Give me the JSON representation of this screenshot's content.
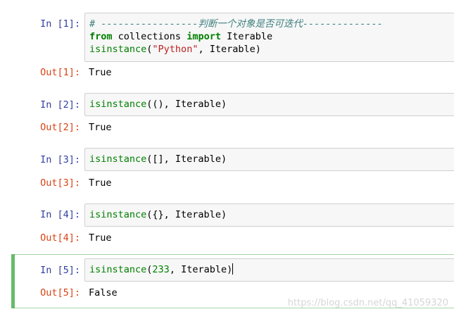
{
  "cells": [
    {
      "in_prompt": "In [1]:",
      "out_prompt": "Out[1]:",
      "code": {
        "comment": "# -----------------判断一个对象是否可迭代--------------",
        "line2_kw_from": "from",
        "line2_module": " collections ",
        "line2_kw_import": "import",
        "line2_name": " Iterable",
        "line3_func": "isinstance",
        "line3_open": "(",
        "line3_str": "\"Python\"",
        "line3_rest": ", Iterable)"
      },
      "output": "True"
    },
    {
      "in_prompt": "In [2]:",
      "out_prompt": "Out[2]:",
      "code": {
        "func": "isinstance",
        "args": "((), Iterable)"
      },
      "output": "True"
    },
    {
      "in_prompt": "In [3]:",
      "out_prompt": "Out[3]:",
      "code": {
        "func": "isinstance",
        "args": "([], Iterable)"
      },
      "output": "True"
    },
    {
      "in_prompt": "In [4]:",
      "out_prompt": "Out[4]:",
      "code": {
        "func": "isinstance",
        "args": "({}, Iterable)"
      },
      "output": "True"
    },
    {
      "in_prompt": "In [5]:",
      "out_prompt": "Out[5]:",
      "code": {
        "func": "isinstance",
        "args_open": "(",
        "num": "233",
        "args_rest": ", Iterable)"
      },
      "output": "False"
    }
  ],
  "watermark": "https://blog.csdn.net/qq_41059320",
  "colors": {
    "in_prompt": "#303f9f",
    "out_prompt": "#d84315",
    "keyword": "#008000",
    "string": "#ba2121",
    "comment": "#408080",
    "selected_cell": "#66bb6a"
  }
}
